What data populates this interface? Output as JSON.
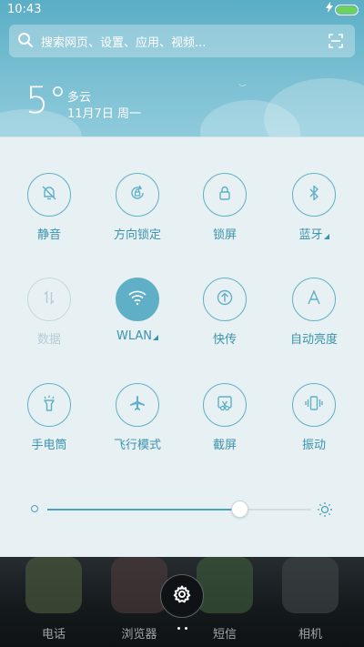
{
  "status_bar": {
    "time": "10:43",
    "battery_color": "#6fd15a"
  },
  "search": {
    "placeholder": "搜索网页、设置、应用、视频..."
  },
  "weather": {
    "temperature": "5°",
    "condition": "多云",
    "date": "11月7日 周一"
  },
  "tiles": [
    {
      "label": "静音",
      "icon": "bell-off-icon",
      "state": "off"
    },
    {
      "label": "方向锁定",
      "icon": "rotation-lock-icon",
      "state": "off"
    },
    {
      "label": "锁屏",
      "icon": "lock-icon",
      "state": "off"
    },
    {
      "label": "蓝牙",
      "icon": "bluetooth-icon",
      "state": "off",
      "has_menu": true
    },
    {
      "label": "数据",
      "icon": "mobile-data-icon",
      "state": "disabled"
    },
    {
      "label": "WLAN",
      "icon": "wifi-icon",
      "state": "on",
      "has_menu": true
    },
    {
      "label": "快传",
      "icon": "share-upload-icon",
      "state": "off"
    },
    {
      "label": "自动亮度",
      "icon": "auto-brightness-icon",
      "state": "off"
    },
    {
      "label": "手电筒",
      "icon": "flashlight-icon",
      "state": "off"
    },
    {
      "label": "飞行模式",
      "icon": "airplane-icon",
      "state": "off"
    },
    {
      "label": "截屏",
      "icon": "screenshot-icon",
      "state": "off"
    },
    {
      "label": "振动",
      "icon": "vibrate-icon",
      "state": "off"
    }
  ],
  "brightness": {
    "level": 0.73
  },
  "dock": {
    "apps": [
      {
        "label": "电话",
        "icon": "phone-icon"
      },
      {
        "label": "浏览器",
        "icon": "browser-icon"
      },
      {
        "label": "短信",
        "icon": "messages-icon"
      },
      {
        "label": "相机",
        "icon": "camera-icon"
      }
    ]
  },
  "colors": {
    "accent": "#5fb0c6",
    "panel_bg": "#e7f0f2",
    "header_bg": "#6cb7cc"
  }
}
